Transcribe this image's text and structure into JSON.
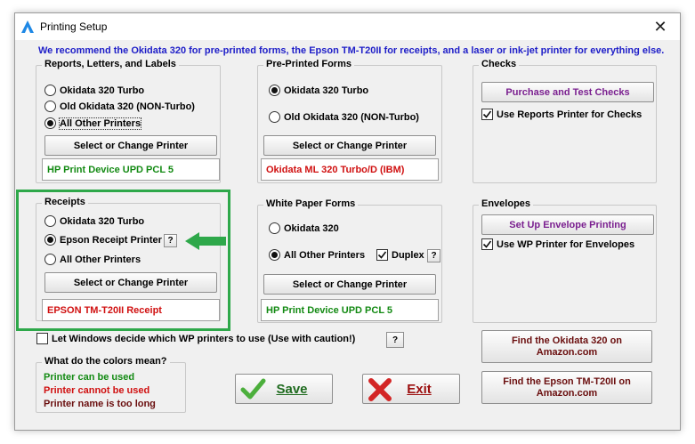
{
  "window": {
    "title": "Printing Setup"
  },
  "banner": "We recommend the Okidata 320 for pre-printed forms, the Epson TM-T20II for receipts, and a laser or ink-jet printer for everything else.",
  "reports": {
    "title": "Reports, Letters, and Labels",
    "options": [
      "Okidata 320 Turbo",
      "Old Okidata 320 (NON-Turbo)",
      "All Other Printers"
    ],
    "selected": "All Other Printers",
    "button": "Select or Change Printer",
    "printer": "HP Print Device UPD PCL 5"
  },
  "preprinted": {
    "title": "Pre-Printed Forms",
    "options": [
      "Okidata 320 Turbo",
      "Old Okidata 320 (NON-Turbo)"
    ],
    "selected": "Okidata 320 Turbo",
    "button": "Select or Change Printer",
    "printer": "Okidata ML 320 Turbo/D (IBM)"
  },
  "checks": {
    "title": "Checks",
    "button": "Purchase and Test Checks",
    "checkbox": "Use Reports Printer for Checks",
    "checked": true
  },
  "receipts": {
    "title": "Receipts",
    "options": [
      "Okidata 320 Turbo",
      "Epson Receipt Printer",
      "All Other Printers"
    ],
    "selected": "Epson Receipt Printer",
    "help": "?",
    "button": "Select or Change Printer",
    "printer": "EPSON TM-T20II Receipt"
  },
  "whitepaper": {
    "title": "White Paper Forms",
    "options": [
      "Okidata 320",
      "All Other Printers"
    ],
    "selected": "All Other Printers",
    "duplex_label": "Duplex",
    "duplex_checked": true,
    "help": "?",
    "button": "Select or Change Printer",
    "printer": "HP Print Device UPD PCL 5"
  },
  "envelopes": {
    "title": "Envelopes",
    "button": "Set Up Envelope Printing",
    "checkbox": "Use WP Printer for Envelopes",
    "checked": true
  },
  "windows_decide": {
    "label": "Let Windows decide which WP printers to use (Use with caution!)",
    "checked": false,
    "help": "?"
  },
  "legend": {
    "title": "What do the colors mean?",
    "items": [
      "Printer can be used",
      "Printer cannot be used",
      "Printer name is too long"
    ]
  },
  "actions": {
    "save": "Save",
    "exit": "Exit"
  },
  "amazon": {
    "okidata_line1": "Find the Okidata 320 on",
    "okidata_line2": "Amazon.com",
    "epson_line1": "Find the Epson TM-T20II on",
    "epson_line2": "Amazon.com"
  },
  "colors": {
    "banner": "#1e1ec8",
    "ok": "#138a13",
    "bad": "#d01010",
    "too_long": "#6a0e0e",
    "highlight": "#2ea84a",
    "purple": "#7a1f8f"
  }
}
